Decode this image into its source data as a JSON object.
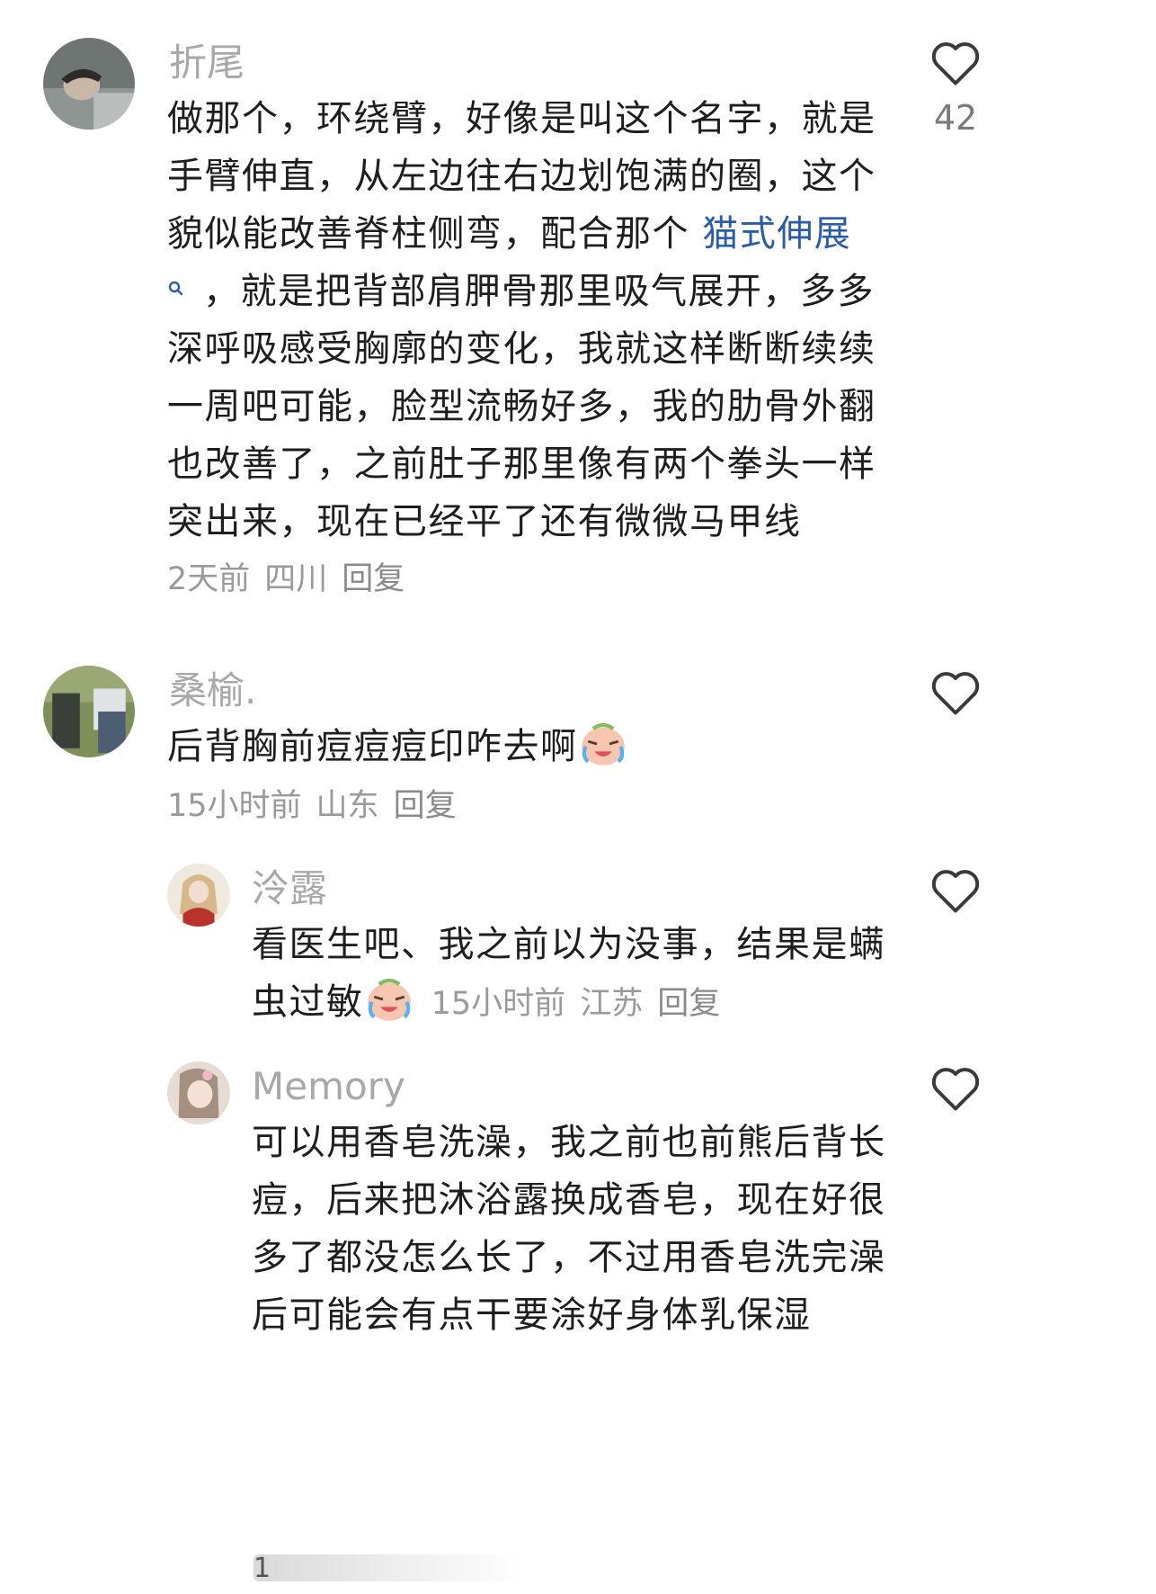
{
  "comments": [
    {
      "user": "折尾",
      "lines": [
        "做那个，环绕臂，好像是叫这个名字，就是",
        "手臂伸直，从左边往右边划饱满的圈，这个",
        "貌似能改善脊柱侧弯，配合那个 ",
        "，就是把背部肩胛骨那里吸气展开，多多",
        "深呼吸感受胸廓的变化，我就这样断断续续",
        "一周吧可能，脸型流畅好多，我的肋骨外翻",
        "也改善了，之前肚子那里像有两个拳头一样",
        "突出来，现在已经平了还有微微马甲线"
      ],
      "link_text": "猫式伸展",
      "time": "2天前",
      "location": "四川",
      "reply": "回复",
      "likes": "42"
    },
    {
      "user": "桑榆.",
      "text": "后背胸前痘痘痘印咋去啊",
      "emoji": "crying-laugh-emoji",
      "time": "15小时前",
      "location": "山东",
      "reply": "回复"
    },
    {
      "user": "泠露",
      "lines": [
        "看医生吧、我之前以为没事，结果是螨",
        "虫过敏"
      ],
      "emoji": "crying-laugh-emoji",
      "time": "15小时前",
      "location": "江苏",
      "reply": "回复"
    },
    {
      "user": "Memory",
      "lines": [
        "可以用香皂洗澡，我之前也前熊后背长",
        "痘，后来把沐浴露换成香皂，现在好很",
        "多了都没怎么长了，不过用香皂洗完澡",
        "后可能会有点干要涂好身体乳保湿"
      ]
    }
  ],
  "footer_fragment": "1",
  "colors": {
    "link": "#2a5caa",
    "username": "#a8a8a8",
    "body_text": "#1e1e1e",
    "meta_text": "#9a9a9a"
  },
  "icons": {
    "like": "heart-outline-icon",
    "search": "search-icon"
  }
}
